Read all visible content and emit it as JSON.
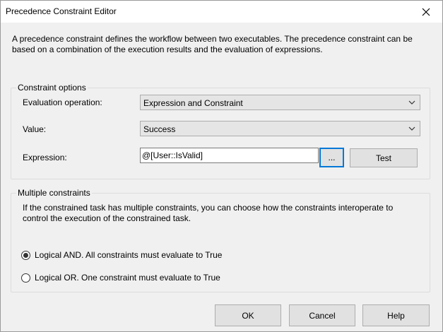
{
  "window": {
    "title": "Precedence Constraint Editor",
    "close_icon": "close-icon"
  },
  "description": "A precedence constraint defines the workflow between two executables. The precedence constraint can be based on a combination of the execution results and the evaluation of expressions.",
  "constraint_options": {
    "legend": "Constraint options",
    "evaluation_label": "Evaluation operation:",
    "evaluation_value": "Expression and Constraint",
    "value_label": "Value:",
    "value_value": "Success",
    "expression_label": "Expression:",
    "expression_value": "@[User::IsValid]",
    "ellipsis_label": "...",
    "test_label": "Test"
  },
  "multiple_constraints": {
    "legend": "Multiple constraints",
    "note": "If the constrained task has multiple constraints, you can choose how the constraints interoperate to control the execution of the constrained task.",
    "options": [
      {
        "label": "Logical AND. All constraints must evaluate to True",
        "checked": true
      },
      {
        "label": "Logical OR. One constraint must evaluate to True",
        "checked": false
      }
    ]
  },
  "buttons": {
    "ok": "OK",
    "cancel": "Cancel",
    "help": "Help"
  },
  "colors": {
    "focus_accent": "#0078d7"
  }
}
